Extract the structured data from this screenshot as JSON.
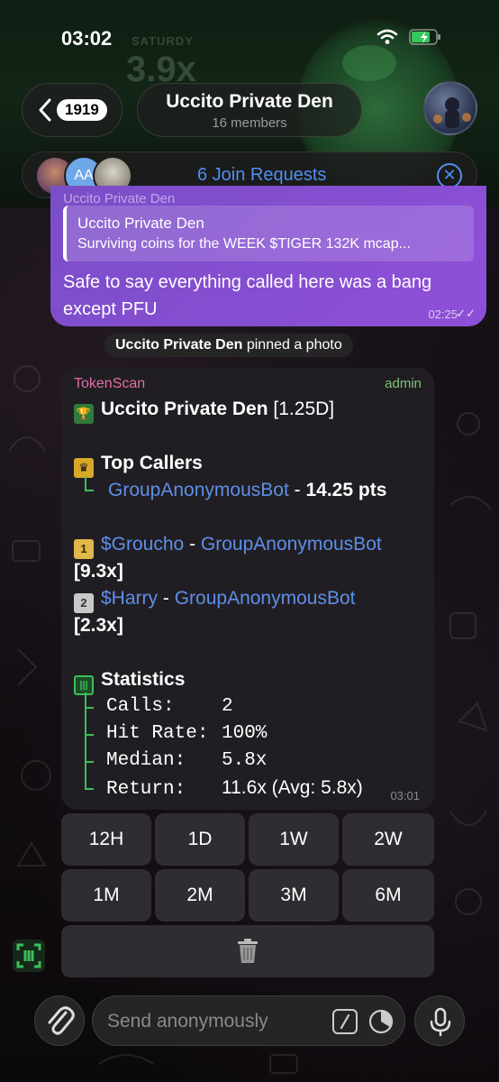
{
  "status_bar": {
    "time": "03:02"
  },
  "header": {
    "back_count": "1919",
    "title": "Uccito Private Den",
    "subtitle": "16 members"
  },
  "join_requests": {
    "label": "6 Join Requests"
  },
  "outgoing": {
    "cut_sender": "Uccito Private Den",
    "reply_title": "Uccito Private Den",
    "reply_text": "Surviving coins for the WEEK $TIGER 132K mcap...",
    "text": "Safe to say everything called here was a bang except PFU",
    "time": "02:25"
  },
  "service": {
    "actor": "Uccito Private Den",
    "action": "pinned a photo"
  },
  "bot_message": {
    "sender": "TokenScan",
    "tag": "admin",
    "group_name": "Uccito Private Den",
    "period": "[1.25D]",
    "top_callers_heading": "Top Callers",
    "top_caller_name": "GroupAnonymousBot",
    "top_caller_sep": "-",
    "top_caller_pts": "14.25 pts",
    "rank1_badge": "1",
    "rank1_token": "$Groucho",
    "rank1_caller": "GroupAnonymousBot",
    "rank1_mult": "[9.3x]",
    "rank2_badge": "2",
    "rank2_token": "$Harry",
    "rank2_caller": "GroupAnonymousBot",
    "rank2_mult": "[2.3x]",
    "dash": "-",
    "stats_heading": "Statistics",
    "stats": [
      {
        "label": "Calls:",
        "value": "2"
      },
      {
        "label": "Hit Rate:",
        "value": "100%"
      },
      {
        "label": "Median:",
        "value": "5.8x"
      },
      {
        "label": "Return:",
        "value": "11.6x (Avg: 5.8x)"
      }
    ],
    "time": "03:01"
  },
  "keyboard": {
    "row1": [
      "12H",
      "1D",
      "1W",
      "2W"
    ],
    "row2": [
      "1M",
      "2M",
      "3M",
      "6M"
    ]
  },
  "composer": {
    "placeholder": "Send anonymously"
  },
  "colors": {
    "accent_blue": "#4f8ff0",
    "link": "#5d8fe8",
    "bubble_purple": "#8f4fd8",
    "sender_pink": "#e06fa7",
    "admin_green": "#7bc47a",
    "tree_green": "#3bbf5a"
  },
  "icons": [
    "back-chevron-icon",
    "wifi-icon",
    "battery-icon",
    "close-icon",
    "trophy-icon",
    "crown-icon",
    "statistics-icon",
    "trash-icon",
    "scan-icon",
    "paperclip-icon",
    "command-icon",
    "schedule-icon",
    "microphone-icon"
  ]
}
